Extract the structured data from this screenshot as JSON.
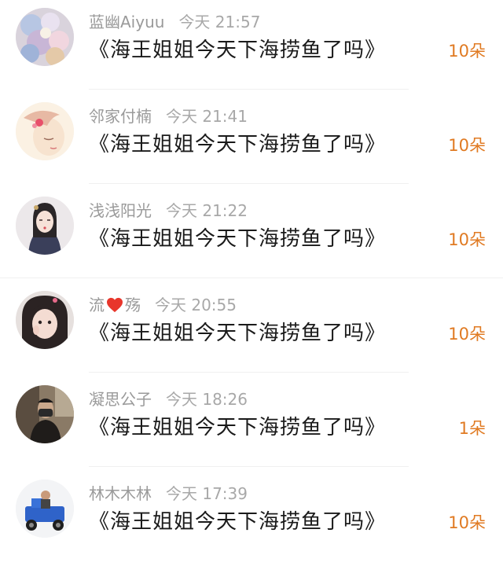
{
  "comments": [
    {
      "user": "蓝幽Aiyuu",
      "time": "今天 21:57",
      "text": "《海王姐姐今天下海捞鱼了吗》",
      "count": "10朵",
      "avatar": "avatar-flowers-icon"
    },
    {
      "user": "邻家付楠",
      "time": "今天 21:41",
      "text": "《海王姐姐今天下海捞鱼了吗》",
      "count": "10朵",
      "avatar": "avatar-girl-illustration-icon"
    },
    {
      "user": "浅浅阳光",
      "time": "今天 21:22",
      "text": "《海王姐姐今天下海捞鱼了吗》",
      "count": "10朵",
      "avatar": "avatar-hanfu-girl-icon"
    },
    {
      "user_prefix": "流",
      "user_suffix": "殇",
      "time": "今天 20:55",
      "text": "《海王姐姐今天下海捞鱼了吗》",
      "count": "10朵",
      "avatar": "avatar-girl-photo-icon"
    },
    {
      "user": "凝思公子",
      "time": "今天 18:26",
      "text": "《海王姐姐今天下海捞鱼了吗》",
      "count": "1朵",
      "avatar": "avatar-masked-man-icon"
    },
    {
      "user": "林木木林",
      "time": "今天 17:39",
      "text": "《海王姐姐今天下海捞鱼了吗》",
      "count": "10朵",
      "avatar": "avatar-tricycle-man-icon"
    }
  ],
  "colors": {
    "accent": "#e07a22",
    "username": "#9a9a9a",
    "title": "#1a1a1a",
    "heart": "#e8362b"
  }
}
